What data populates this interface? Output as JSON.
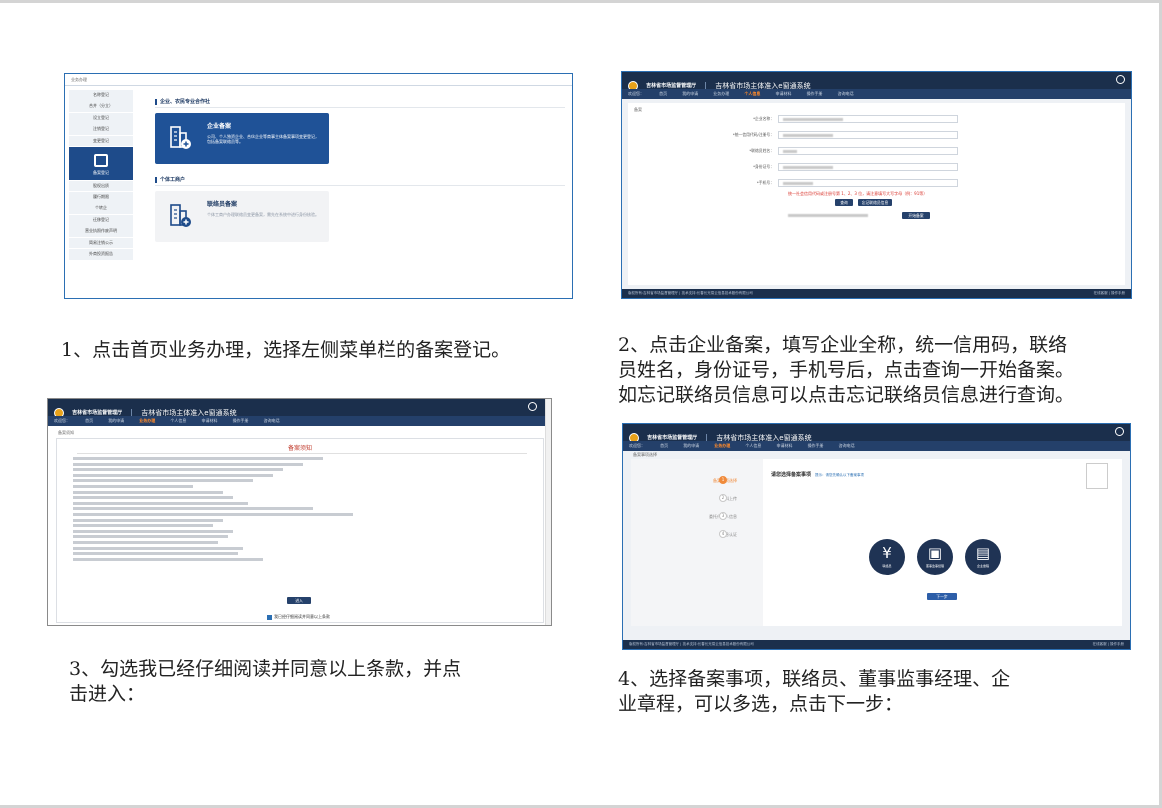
{
  "captions": {
    "step1": "1、点击首页业务办理，选择左侧菜单栏的备案登记。",
    "step2_l1": "2、点击企业备案，填写企业全称，统一信用码，联络",
    "step2_l2": "员姓名，身份证号，手机号后，点击查询一开始备案。",
    "step2_l3": "如忘记联络员信息可以点击忘记联络员信息进行查询。",
    "step3_l1": "3、勾选我已经仔细阅读并同意以上条款，并点",
    "step3_l2": "击进入：",
    "step4_l1": "4、选择备案事项，联络员、董事监事经理、企",
    "step4_l2": "业章程，可以多选，点击下一步："
  },
  "screen1": {
    "breadcrumb": "业务办理",
    "side_items": [
      "名称登记",
      "合并（分立）",
      "设立登记",
      "注销登记",
      "变更登记",
      "备案登记",
      "股权出质",
      "履行期限",
      "个转企",
      "迁移登记",
      "营业执照作废声明",
      "简易注销公示",
      "外商投资报告"
    ],
    "section1": "企业、农民专业合作社",
    "section2": "个体工商户",
    "card1_title": "企业备案",
    "card1_desc": "公司、个人独资企业、合伙企业等商事主体备案事项变更登记，包括备案联络员等。",
    "card2_title": "联络员备案",
    "card2_desc": "个体工商户办理联络员变更备案，需先在系统中进行身份核验。"
  },
  "app": {
    "org": "吉林省市场监督管理厅",
    "system": "吉林省市场主体准入e窗通系统",
    "nav": [
      "欢迎您：",
      "首页",
      "我的申请",
      "业务办理",
      "个人信息",
      "申请材料",
      "操作手册",
      "咨询电话"
    ],
    "footer_left": "版权所有:吉林省市场监督管理厅 | 技术支持:长春长光易云信息技术股份有限公司",
    "footer_right": "在线客服 | 操作手册"
  },
  "screen2": {
    "crumb": "备案",
    "fields": [
      {
        "label": "*企业名称："
      },
      {
        "label": "*统一信用代码/注册号："
      },
      {
        "label": "*联络员姓名："
      },
      {
        "label": "*身份证号："
      },
      {
        "label": "*手机号："
      }
    ],
    "warning": "统一社会信用代码或注册号第 1、2、3 位，请注意填写大写字母（例：91等）",
    "btn_query": "查询",
    "btn_forget": "忘记联络员信息",
    "btn_start": "开始备案"
  },
  "screen3": {
    "crumb": "备案须知",
    "title": "备案须知",
    "agree": "我已经仔细阅读并同意以上条款",
    "enter": "进入"
  },
  "screen4": {
    "crumb": "备案事项选择",
    "steps": [
      "备案事项选择",
      "材料上传",
      "委托代理人信息",
      "信息认证"
    ],
    "choose": "请您选择备案事项",
    "hint": "提示：请您先确认以下备案事项",
    "options": [
      "联络员",
      "董事监事经理",
      "企业章程"
    ],
    "next": "下一步"
  }
}
